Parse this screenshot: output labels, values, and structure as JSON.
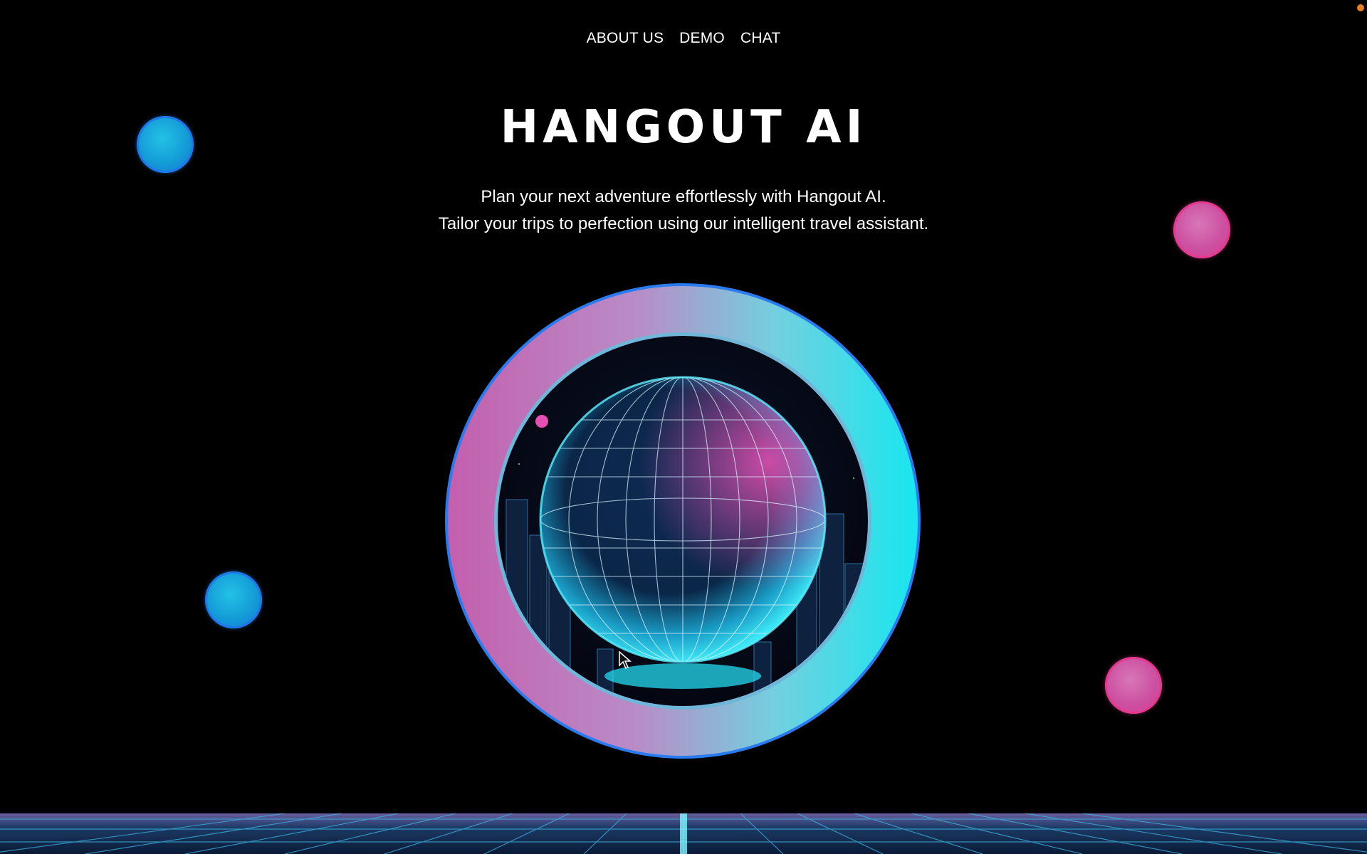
{
  "nav": {
    "items": [
      {
        "label": "ABOUT US"
      },
      {
        "label": "DEMO"
      },
      {
        "label": "CHAT"
      }
    ]
  },
  "hero": {
    "title": "HANGOUT AI",
    "tagline_line1": "Plan your next adventure effortlessly with Hangout AI.",
    "tagline_line2": "Tailor your trips to perfection using our intelligent travel assistant.",
    "image_alt": "globe-city-illustration"
  },
  "colors": {
    "background": "#000000",
    "text": "#ffffff",
    "accent_cyan": "#18e6ee",
    "accent_pink": "#c45fae",
    "ring_border": "#2a7bf0"
  },
  "decorations": {
    "orbs": [
      {
        "color": "blue"
      },
      {
        "color": "pink"
      },
      {
        "color": "blue"
      },
      {
        "color": "pink"
      }
    ]
  },
  "icons": {
    "cursor": "cursor-pointer-icon",
    "status": "notification-dot-icon"
  }
}
